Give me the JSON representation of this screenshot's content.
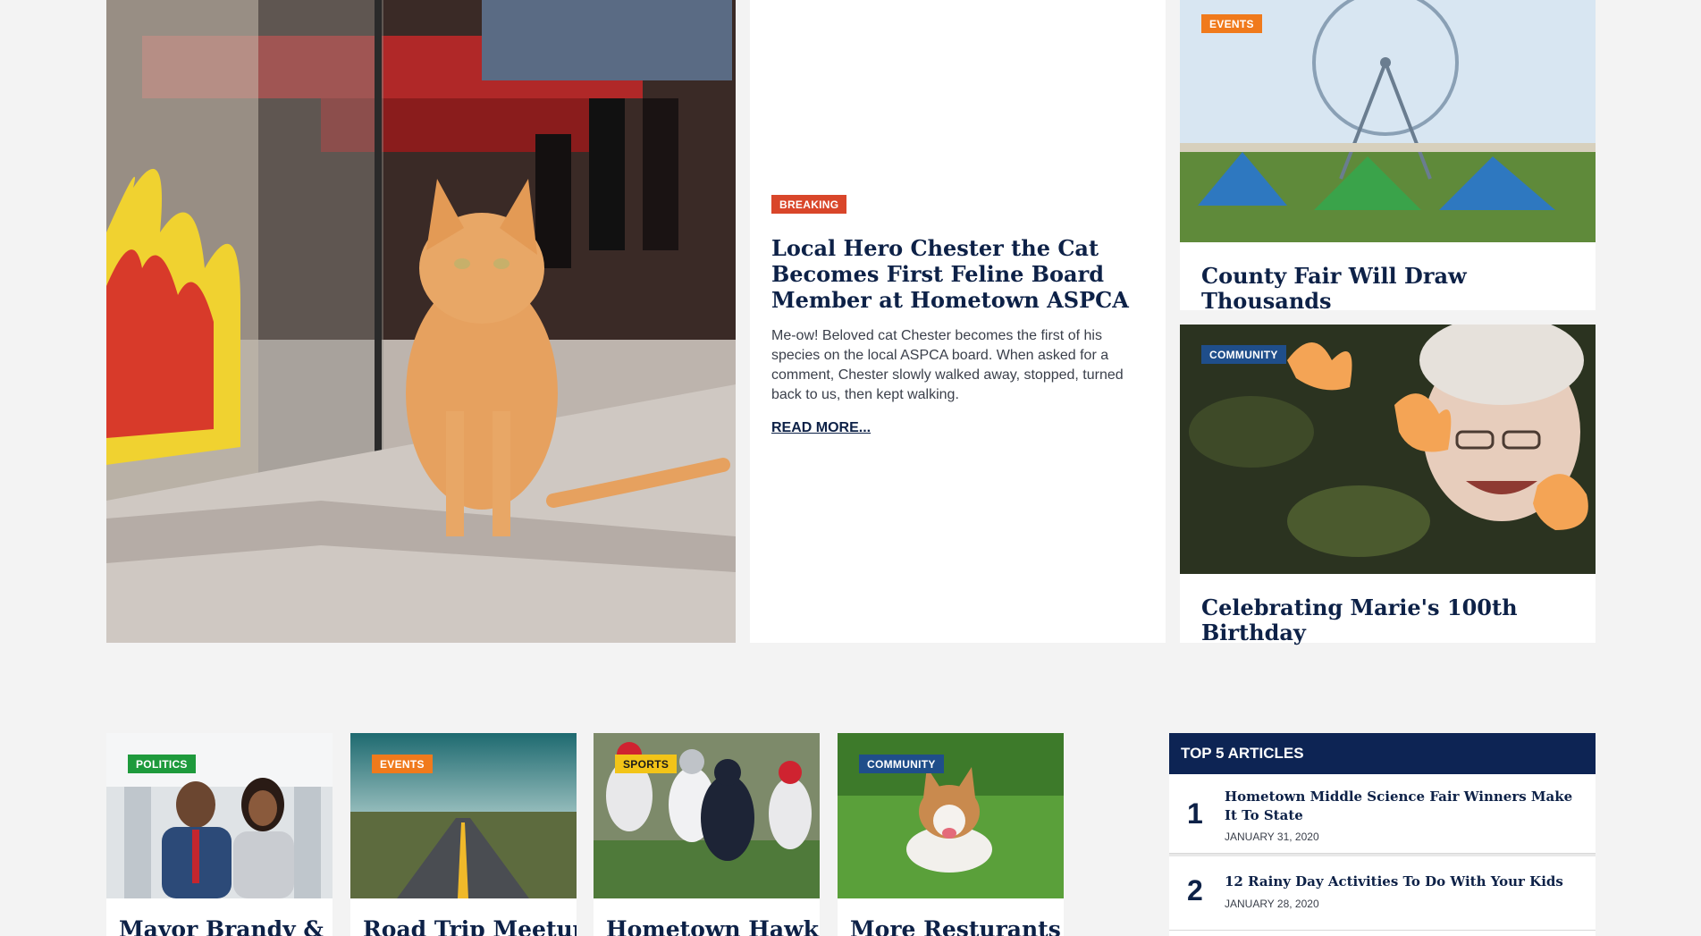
{
  "hero": {
    "badge": "BREAKING",
    "title": "Local Hero Chester the Cat Becomes First Feline Board Member at Hometown ASPCA",
    "excerpt": "Me-ow! Beloved cat Chester becomes the first of his species on the local ASPCA board. When asked for a comment, Chester slowly walked away, stopped, turned back to us, then kept walking.",
    "read_more": "READ MORE..."
  },
  "side_cards": [
    {
      "badge": "EVENTS",
      "title": "County Fair Will Draw Thousands"
    },
    {
      "badge": "COMMUNITY",
      "title": "Celebrating Marie's 100th Birthday"
    }
  ],
  "small_cards": [
    {
      "badge": "POLITICS",
      "title": "Mayor Brandy &"
    },
    {
      "badge": "EVENTS",
      "title": "Road Trip Meetups"
    },
    {
      "badge": "SPORTS",
      "title": "Hometown Hawks"
    },
    {
      "badge": "COMMUNITY",
      "title": "More Resturants"
    }
  ],
  "top5": {
    "heading": "TOP 5 ARTICLES",
    "items": [
      {
        "rank": "1",
        "title": "Hometown Middle Science Fair Winners Make It To State",
        "date": "JANUARY 31, 2020"
      },
      {
        "rank": "2",
        "title": "12 Rainy Day Activities To Do With Your Kids",
        "date": "JANUARY 28, 2020"
      }
    ]
  },
  "colors": {
    "navy": "#0d2454",
    "breaking": "#d9462a",
    "events": "#f07a1c",
    "community": "#1f4e8a",
    "politics": "#1e9a3c",
    "sports": "#f2c418"
  }
}
